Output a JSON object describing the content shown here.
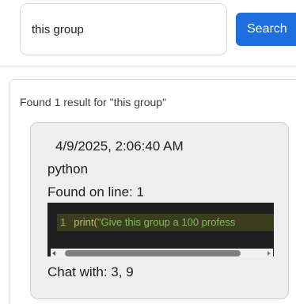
{
  "search": {
    "value": "this group",
    "button_label": "Search"
  },
  "results": {
    "summary": "Found 1 result for \"this group\"",
    "items": [
      {
        "timestamp": "4/9/2025, 2:06:40 AM",
        "language": "python",
        "line_info": "Found on line: 1",
        "code": {
          "line_number": "1",
          "fn": "print(",
          "str": "\"Give this group a 100 profess"
        },
        "chat_with": "Chat with: 3, 9"
      }
    ]
  },
  "colors": {
    "accent": "#1f6ee0",
    "card_background": "#eeeeee",
    "code_background": "#1e1e1e"
  }
}
